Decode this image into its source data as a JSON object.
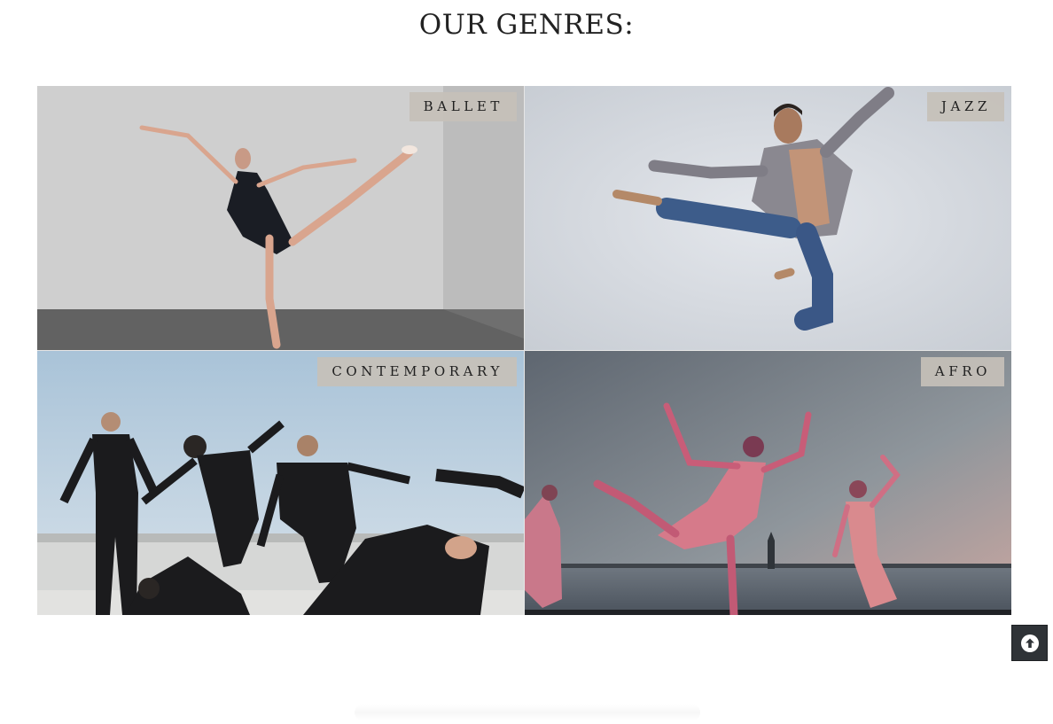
{
  "page": {
    "title": "OUR GENRES:"
  },
  "genres": [
    {
      "label": "BALLET"
    },
    {
      "label": "JAZZ"
    },
    {
      "label": "CONTEMPORARY"
    },
    {
      "label": "AFRO"
    }
  ],
  "scroll_top": {
    "icon": "arrow-up-circle-icon"
  },
  "colors": {
    "label_background": "#c6c0b8",
    "label_text": "#1f1f1f",
    "scroll_button": "#2f3337",
    "title_text": "#222222"
  }
}
